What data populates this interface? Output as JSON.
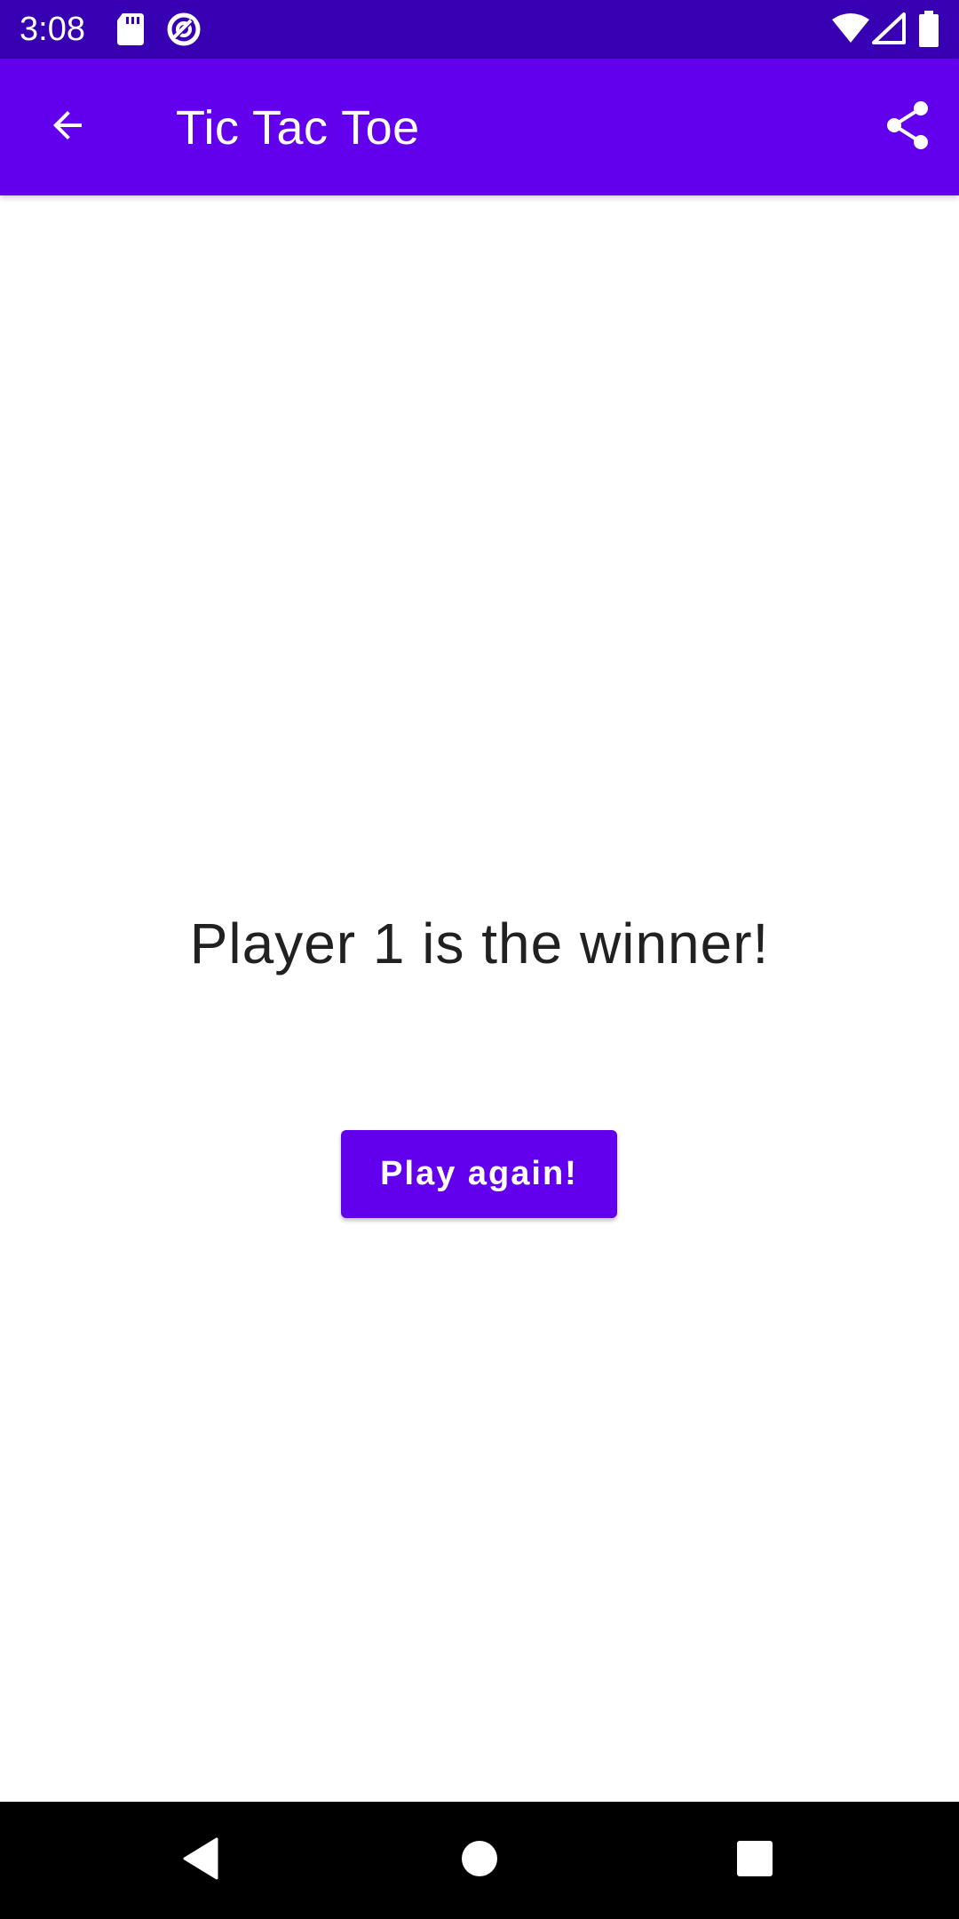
{
  "status_bar": {
    "time": "3:08",
    "left_icons": [
      "sd-card-icon",
      "data-saver-icon"
    ],
    "right_icons": [
      "wifi-icon",
      "cell-signal-icon",
      "battery-icon"
    ],
    "color": "#3700b3"
  },
  "app_bar": {
    "title": "Tic Tac Toe",
    "back_icon": "arrow-back-icon",
    "share_icon": "share-icon",
    "color": "#6200ee"
  },
  "main": {
    "winner_text": "Player 1 is the winner!",
    "play_again_label": "Play again!"
  },
  "nav_bar": {
    "buttons": [
      "back-triangle-icon",
      "home-circle-icon",
      "recents-square-icon"
    ]
  }
}
